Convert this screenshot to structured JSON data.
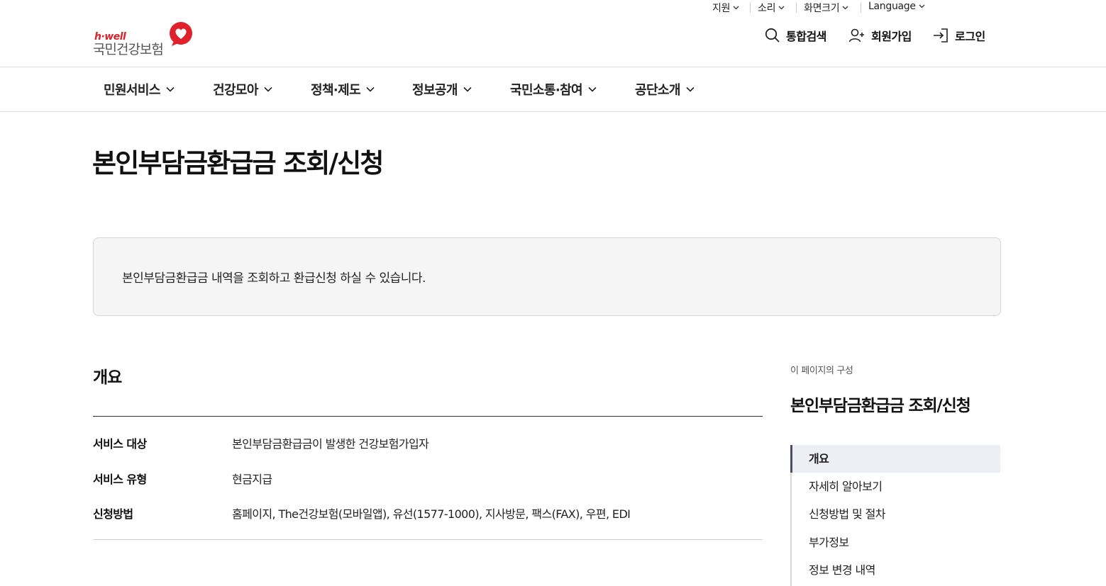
{
  "utility": {
    "items": [
      {
        "label": "지원"
      },
      {
        "label": "소리"
      },
      {
        "label": "화면크기"
      },
      {
        "label": "Language"
      }
    ]
  },
  "logo": {
    "tagline": "h·well",
    "name": "국민건강보험",
    "brand_color": "#e0212b"
  },
  "actions": {
    "search": "통합검색",
    "join": "회원가입",
    "login": "로그인"
  },
  "gnb": {
    "items": [
      {
        "label": "민원서비스"
      },
      {
        "label": "건강모아"
      },
      {
        "label": "정책·제도"
      },
      {
        "label": "정보공개"
      },
      {
        "label": "국민소통·참여"
      },
      {
        "label": "공단소개"
      }
    ]
  },
  "page": {
    "title": "본인부담금환급금 조회/신청",
    "intro": "본인부담금환급금 내역을 조회하고 환급신청 하실 수 있습니다."
  },
  "overview": {
    "title": "개요",
    "rows": [
      {
        "label": "서비스 대상",
        "value": "본인부담금환급금이 발생한 건강보험가입자"
      },
      {
        "label": "서비스 유형",
        "value": "현금지급"
      },
      {
        "label": "신청방법",
        "value": "홈페이지, The건강보험(모바일앱), 유선(1577-1000), 지사방문, 팩스(FAX), 우편, EDI"
      }
    ]
  },
  "toc": {
    "caption": "이 페이지의 구성",
    "title": "본인부담금환급금 조회/신청",
    "items": [
      {
        "label": "개요",
        "active": true
      },
      {
        "label": "자세히 알아보기"
      },
      {
        "label": "신청방법 및 절차"
      },
      {
        "label": "부가정보"
      },
      {
        "label": "정보 변경 내역"
      }
    ],
    "active_color": "#4b4f66"
  }
}
